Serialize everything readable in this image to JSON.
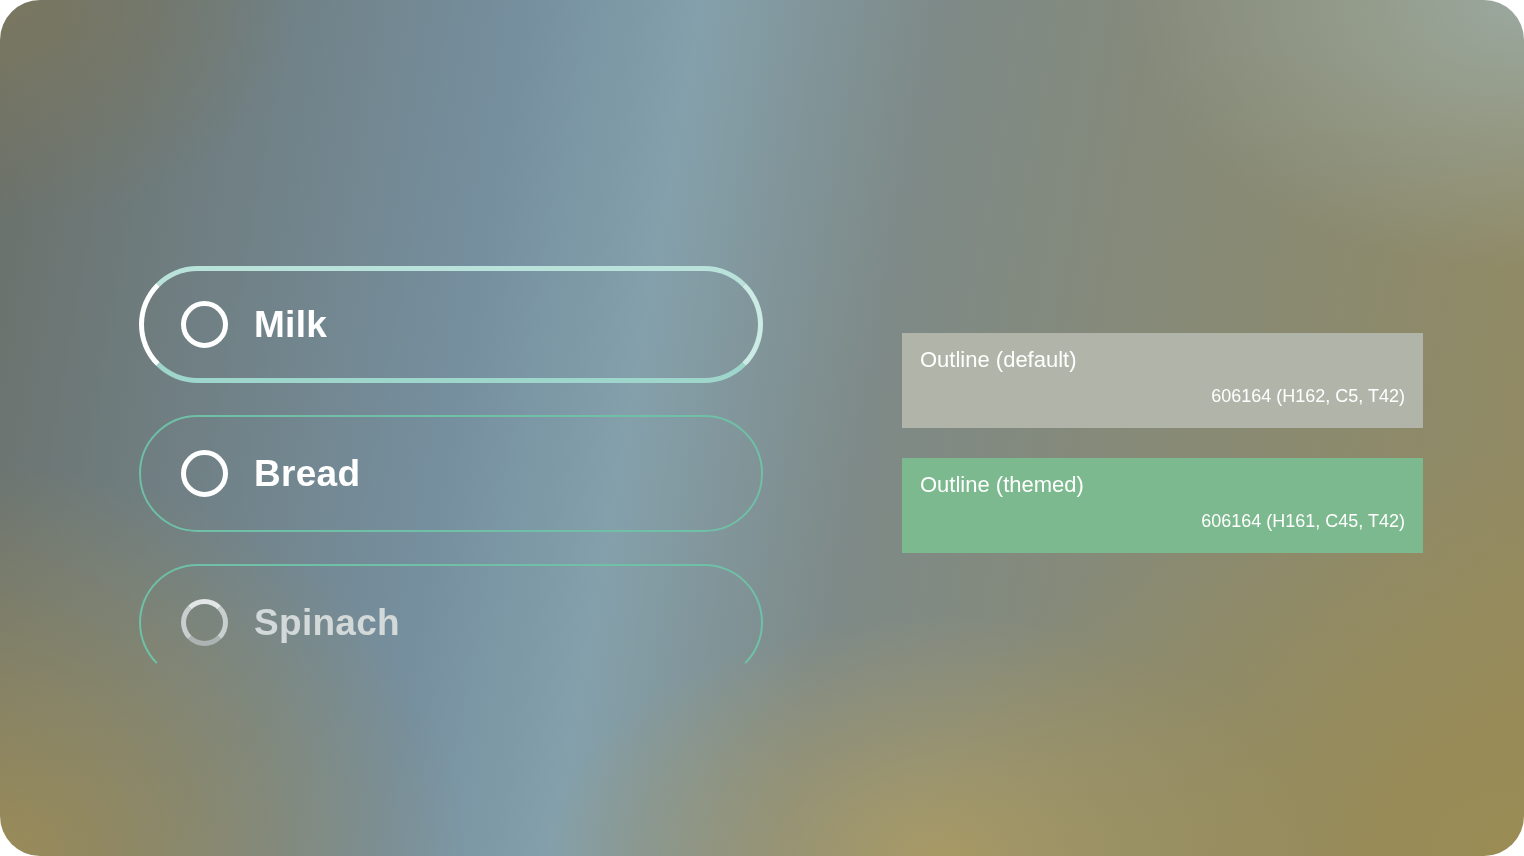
{
  "list": {
    "items": [
      {
        "label": "Milk",
        "focused": true,
        "faded": false,
        "checked": false
      },
      {
        "label": "Bread",
        "focused": false,
        "faded": false,
        "checked": false
      },
      {
        "label": "Spinach",
        "focused": false,
        "faded": true,
        "checked": false
      }
    ]
  },
  "swatches": [
    {
      "title": "Outline (default)",
      "value": "606164 (H162, C5, T42)",
      "color": "#b1b5a9"
    },
    {
      "title": "Outline (themed)",
      "value": "606164 (H161, C45, T42)",
      "color": "#7db98f"
    }
  ]
}
